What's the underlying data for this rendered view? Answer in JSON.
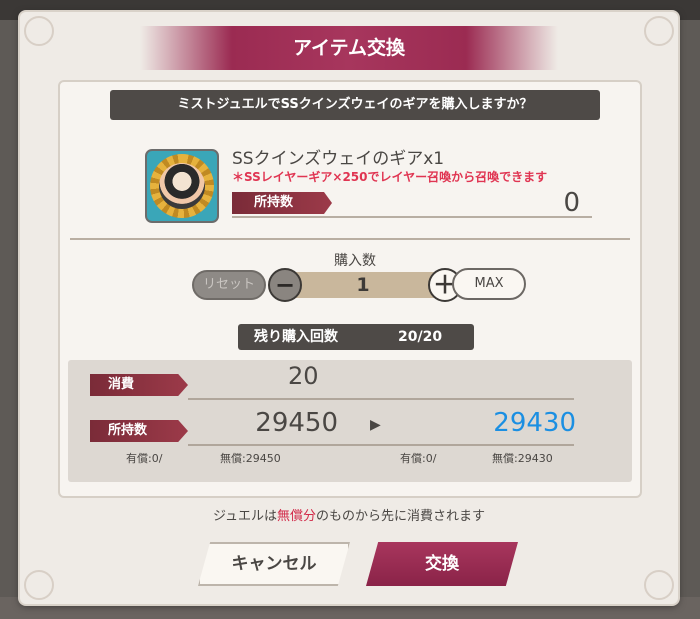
{
  "dialog": {
    "title": "アイテム交換",
    "question": "ミストジュエルでSSクインズウェイのギアを購入しますか？"
  },
  "item": {
    "icon": "gear-character-icon",
    "name": "SSクインズウェイのギアx1",
    "note": "＊SSレイヤーギア×250でレイヤー召喚から召喚できます",
    "owned_label": "所持数",
    "owned_value": "0"
  },
  "purchase": {
    "label": "購入数",
    "reset_label": "リセット",
    "minus_label": "−",
    "quantity": "1",
    "plus_label": "＋",
    "max_label": "MAX"
  },
  "remaining": {
    "label": "残り購入回数",
    "value": "20/20"
  },
  "cost": {
    "cost_label": "消費",
    "cost_value": "20",
    "owned_label": "所持数",
    "before": "29450",
    "arrow": "▶",
    "after": "29430",
    "before_paid": "有償:0/",
    "before_free": "無償:29450",
    "after_paid": "有償:0/",
    "after_free": "無償:29430"
  },
  "note": {
    "prefix": "ジュエルは",
    "highlight": "無償分",
    "suffix": "のものから先に消費されます"
  },
  "buttons": {
    "cancel": "キャンセル",
    "exchange": "交換"
  },
  "colors": {
    "accent": "#9b2b52",
    "after_value": "#1b8fe2",
    "warning": "#e03552"
  }
}
